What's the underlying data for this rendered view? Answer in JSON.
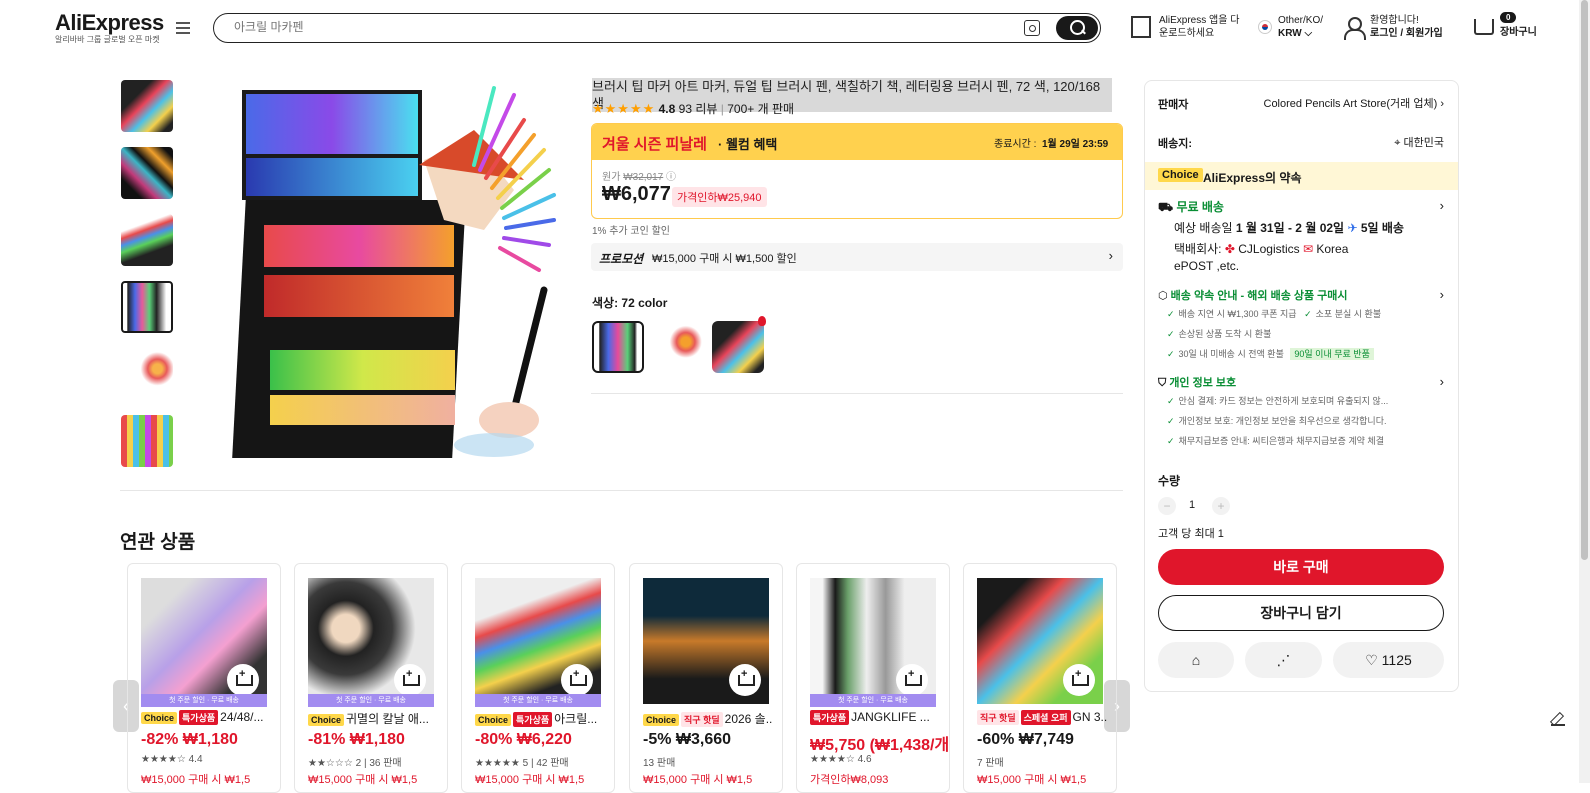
{
  "header": {
    "logo": "AliExpress",
    "logo_sub": "알리바바 그룹 글로벌 오픈 마켓",
    "search_placeholder": "아크릴 마카펜",
    "app_line1": "AliExpress 앱을 다",
    "app_line2": "운로드하세요",
    "region_line1": "Other/KO/",
    "region_line2": "KRW ⌵",
    "welcome_line1": "환영합니다!",
    "welcome_line2": "로그인 / 회원가입",
    "cart_count": "0",
    "cart_label": "장바구니"
  },
  "product": {
    "title": "브러시 팁 마커 아트 마커, 듀얼 팁 브러시 펜, 색칠하기 책, 레터링용 브러시 펜, 72 색, 120/168 색",
    "rating": "4.8",
    "reviews": "93 리뷰",
    "sold": "700+ 개 판매",
    "sale_name": "겨울 시즌 피날레",
    "sale_sub": " · 웰컴 혜택",
    "sale_end_label": "종료시간 :",
    "sale_end_time": "1월 29일 23:59",
    "orig_label": "원가",
    "orig_price": "₩32,017",
    "price": "₩6,077",
    "discount_label": "가격인하₩25,940",
    "coin_note": "1% 추가 코인 할인",
    "promo_label": "프로모션",
    "promo_text": "₩15,000 구매 시 ₩1,500 할인",
    "color_label": "색상: 72 color"
  },
  "panel": {
    "seller_label": "판매자",
    "seller_name": "Colored Pencils Art Store(거래 업체)",
    "ship_to_label": "배송지:",
    "ship_to": "대한민국",
    "choice_tag": "Choice",
    "choice_promise": "AliExpress의 약속",
    "free_ship": "무료 배송",
    "delivery_prefix": "예상 배송일 ",
    "delivery_dates": "1 월 31일 - 2 월 02일",
    "delivery_days": "5일 배송",
    "courier_label": "택배회사:",
    "courier1": "CJLogistics",
    "courier2": "Korea",
    "courier3": "ePOST ,etc.",
    "guarantee_title": "배송 약속 안내 - 해외 배송 상품 구매시",
    "g1": "배송 지연 시 ₩1,300 쿠폰 지급",
    "g2": "소포 분실 시 환불",
    "g3": "손상된 상품 도착 시 환불",
    "g4": "30일 내 미배송 시 전액 환불",
    "g4_badge": "90일 이내 무료 반품",
    "privacy_title": "개인 정보 보호",
    "p1": "안심 결제: 카드 정보는 안전하게 보호되며 유출되지 않...",
    "p2": "개인정보 보호: 개인정보 보안을 최우선으로 생각합니다.",
    "p3": "채무지급보증 안내: 씨티은행과 채무지급보증 계약 체결",
    "qty_label": "수량",
    "qty": "1",
    "max_note": "고객 당 최대 1",
    "buy_now": "바로 구매",
    "add_cart": "장바구니 담기",
    "wish_count": "1125"
  },
  "related": {
    "title": "연관 상품",
    "cards": [
      {
        "strip": "첫 주문 할인 · 무료 배송",
        "b1": "Choice",
        "b2": "특가상품",
        "name": "24/48/...",
        "price": "-82% ₩1,180",
        "sub": "★★★★☆ 4.4",
        "promo": "₩15,000 구매 시 ₩1,5"
      },
      {
        "strip": "첫 주문 할인 · 무료 배송",
        "b1": "Choice",
        "b2": "",
        "name": "귀멸의 칼날 애...",
        "price": "-81% ₩1,180",
        "sub": "★★☆☆☆ 2 | 36 판매",
        "promo": "₩15,000 구매 시 ₩1,5"
      },
      {
        "strip": "첫 주문 할인 · 무료 배송",
        "b1": "Choice",
        "b2": "특가상품",
        "name": "아크릴...",
        "price": "-80% ₩6,220",
        "sub": "★★★★★ 5 | 42 판매",
        "promo": "₩15,000 구매 시 ₩1,5"
      },
      {
        "strip": "",
        "b1": "Choice",
        "b2": "직구 핫딜",
        "name": "2026 솔...",
        "price": "-5% ₩3,660",
        "sub": "13 판매",
        "promo": "₩15,000 구매 시 ₩1,5"
      },
      {
        "strip": "첫 주문 할인 · 무료 배송",
        "b1": "",
        "b2": "특가상품",
        "name": "JANGKLIFE ...",
        "price": "₩5,750 (₩1,438/개)",
        "sub": "★★★★☆ 4.6",
        "promo": "가격인하₩8,093"
      },
      {
        "strip": "",
        "b1": "직구 핫딜",
        "b2": "스페셜 오퍼",
        "name": "GN 3...",
        "price": "-60% ₩7,749",
        "sub": "7 판매",
        "promo": "₩15,000 구매 시 ₩1,5"
      }
    ]
  }
}
